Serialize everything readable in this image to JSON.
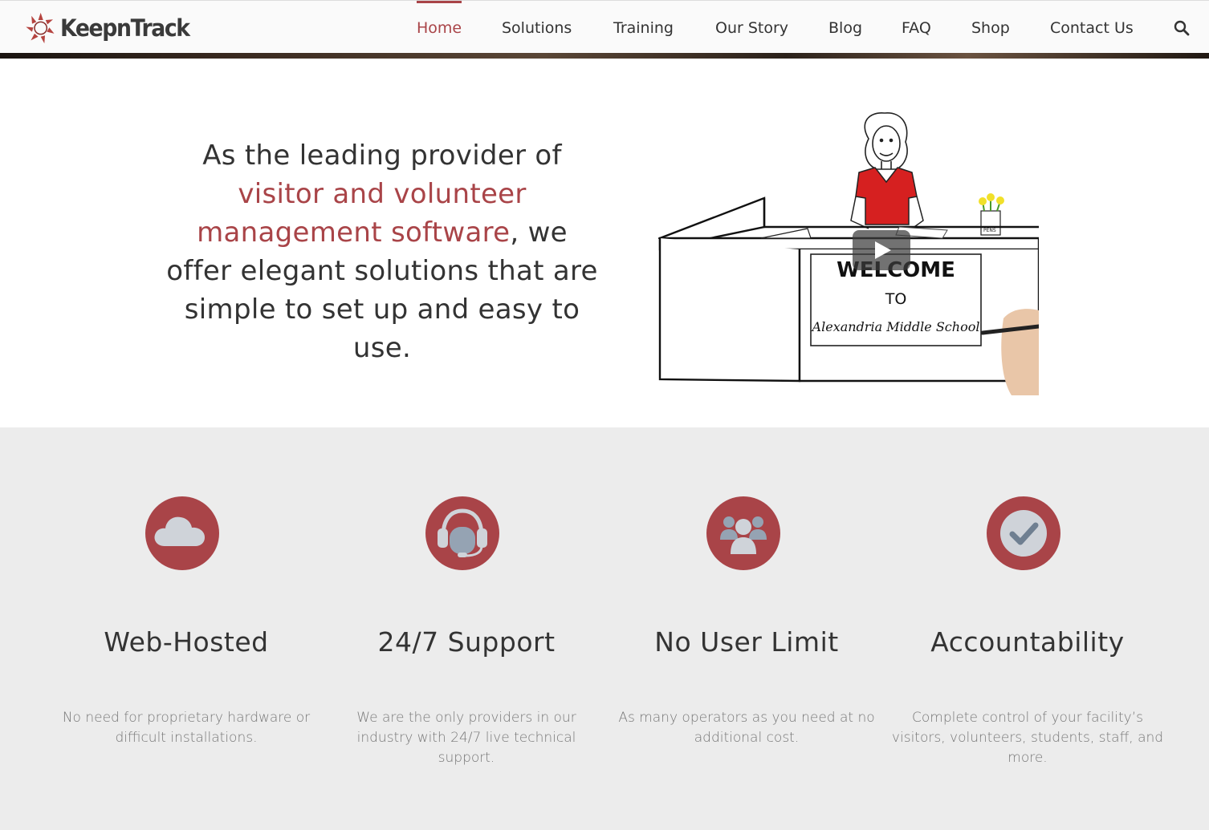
{
  "header": {
    "logo_text": "KeepnTrack",
    "nav": [
      {
        "label": "Home",
        "active": true
      },
      {
        "label": "Solutions",
        "active": false
      },
      {
        "label": "Training",
        "active": false
      },
      {
        "label": "Our Story",
        "active": false
      },
      {
        "label": "Blog",
        "active": false
      },
      {
        "label": "FAQ",
        "active": false
      },
      {
        "label": "Shop",
        "active": false
      },
      {
        "label": "Contact Us",
        "active": false
      }
    ],
    "search_icon": "search-icon"
  },
  "hero": {
    "line_part1": "As the leading provider of",
    "highlight": "visitor and volunteer management software",
    "line_part2": ", we offer elegant solutions that are simple to set up and easy to use.",
    "video": {
      "sign_line1": "WELCOME",
      "sign_line2": "TO",
      "sign_line3": "Alexandria Middle School",
      "cup_label": "PENS"
    }
  },
  "features": [
    {
      "icon": "cloud-icon",
      "title": "Web-Hosted",
      "desc": "No need for proprietary hardware or difficult installations."
    },
    {
      "icon": "headset-icon",
      "title": "24/7 Support",
      "desc": "We are the only providers in our industry with 24/7 live technical support."
    },
    {
      "icon": "users-icon",
      "title": "No User Limit",
      "desc": "As many operators as you need at no additional cost."
    },
    {
      "icon": "checkmark-icon",
      "title": "Accountability",
      "desc": "Complete control of your facility’s visitors, volunteers, students, staff, and more."
    }
  ],
  "colors": {
    "accent": "#a94448",
    "feature_bg": "#ececec",
    "icon_fill": "#cfd3d9"
  }
}
